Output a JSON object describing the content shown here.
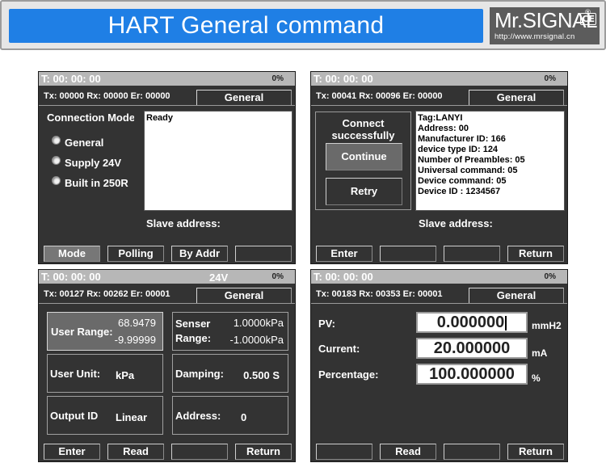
{
  "header": {
    "title": "HART General command",
    "logo_name": "Mr.SIGNAL",
    "logo_reg": "®",
    "logo_ce": "CE",
    "logo_url": "http://www.mrsignal.cn"
  },
  "screens": [
    {
      "time": "T: 00: 00: 00",
      "percent": "0%",
      "counts": "Tx: 00000  Rx: 00000  Er: 00000",
      "mode": "General",
      "connection_mode_title": "Connection Mode",
      "radio_options": [
        "General",
        "Supply 24V",
        "Built in 250R"
      ],
      "status_text": "Ready",
      "slave_address_label": "Slave address:",
      "fkeys": [
        "Mode",
        "Polling",
        "By Addr",
        ""
      ]
    },
    {
      "time": "T: 00: 00: 00",
      "percent": "0%",
      "counts": "Tx: 00041  Rx: 00096  Er: 00000",
      "mode": "General",
      "connect_msg_line1": "Connect",
      "connect_msg_line2": "successfully",
      "continue_label": "Continue",
      "retry_label": "Retry",
      "info_lines": [
        "Tag:LANYI",
        "Address: 00",
        "Manufacturer ID: 166",
        "device type ID: 124",
        "Number of Preambles: 05",
        "Universal command: 05",
        "Device command: 05",
        "Device ID : 1234567"
      ],
      "slave_address_label": "Slave address:",
      "fkeys": [
        "Enter",
        "",
        "",
        "Return"
      ]
    },
    {
      "time": "T: 00: 00: 00",
      "voltage": "24V",
      "percent": "0%",
      "counts": "Tx: 00127  Rx: 00262  Er: 00001",
      "mode": "General",
      "user_range_label": "User Range:",
      "user_range_upper": "68.9479",
      "user_range_lower": "-9.99999",
      "sensor_range_label1": "Senser",
      "sensor_range_label2": "Range:",
      "sensor_range_upper": "1.0000kPa",
      "sensor_range_lower": "-1.0000kPa",
      "user_unit_label": "User Unit:",
      "user_unit_value": "kPa",
      "damping_label": "Damping:",
      "damping_value": "0.500 S",
      "output_id_label": "Output ID",
      "output_id_value": "Linear",
      "address_label": "Address:",
      "address_value": "0",
      "fkeys": [
        "Enter",
        "Read",
        "",
        "Return"
      ]
    },
    {
      "time": "T: 00: 00: 00",
      "percent": "0%",
      "counts": "Tx: 00183  Rx: 00353  Er: 00001",
      "mode": "General",
      "pv_label": "PV:",
      "pv_value": "0.000000",
      "pv_unit": "mmH2",
      "current_label": "Current:",
      "current_value": "20.000000",
      "current_unit": "mA",
      "percentage_label": "Percentage:",
      "percentage_value": "100.000000",
      "percentage_unit": "%",
      "fkeys": [
        "",
        "Read",
        "",
        "Return"
      ]
    }
  ]
}
